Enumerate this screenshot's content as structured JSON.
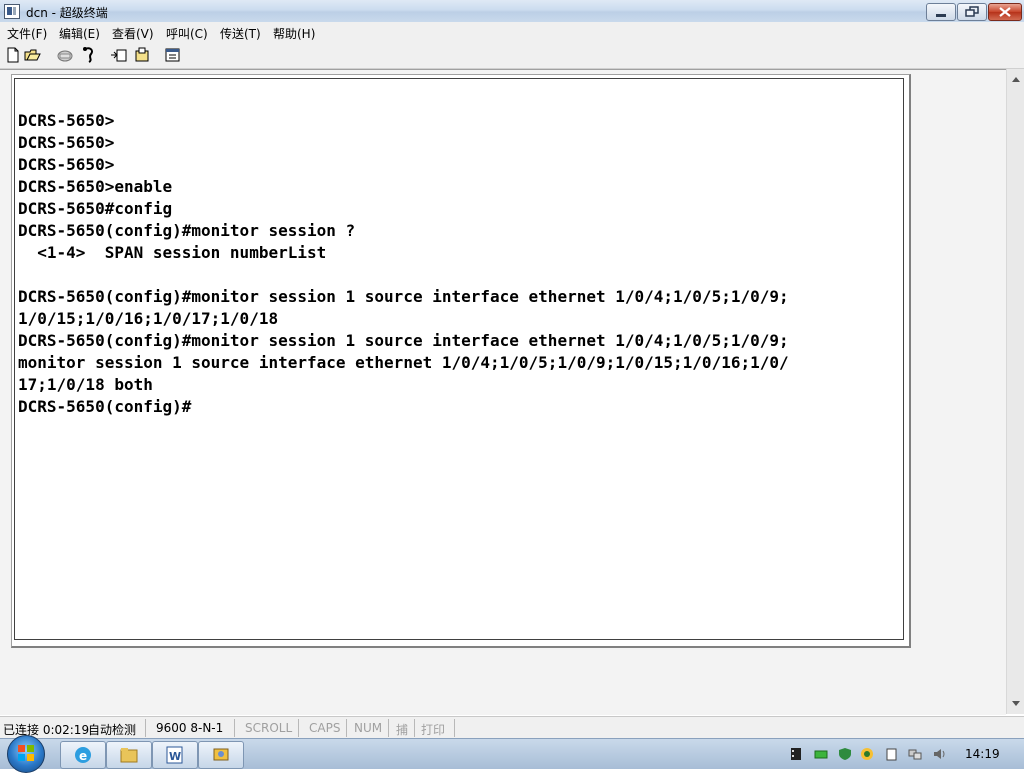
{
  "window": {
    "title": "dcn - 超级终端"
  },
  "menu": {
    "items": [
      "文件(F)",
      "编辑(E)",
      "查看(V)",
      "呼叫(C)",
      "传送(T)",
      "帮助(H)"
    ]
  },
  "toolbar": {
    "icons": [
      "new-icon",
      "open-icon",
      "disconnect-icon",
      "call-icon",
      "send-icon",
      "receive-icon",
      "properties-icon"
    ]
  },
  "terminal": {
    "lines": [
      "DCRS-5650>",
      "DCRS-5650>",
      "DCRS-5650>",
      "DCRS-5650>enable",
      "DCRS-5650#config",
      "DCRS-5650(config)#monitor session ?",
      "  <1-4>  SPAN session numberList",
      "",
      "DCRS-5650(config)#monitor session 1 source interface ethernet 1/0/4;1/0/5;1/0/9;",
      "1/0/15;1/0/16;1/0/17;1/0/18",
      "DCRS-5650(config)#monitor session 1 source interface ethernet 1/0/4;1/0/5;1/0/9;",
      "monitor session 1 source interface ethernet 1/0/4;1/0/5;1/0/9;1/0/15;1/0/16;1/0/",
      "17;1/0/18 both",
      "DCRS-5650(config)#"
    ]
  },
  "status": {
    "connection": "已连接 0:02:19",
    "detect": "自动检测",
    "baud": "9600 8-N-1",
    "scroll": "SCROLL",
    "caps": "CAPS",
    "num": "NUM",
    "capture": "捕",
    "print": "打印"
  },
  "taskbar": {
    "clock": "14:19",
    "buttons": [
      "ie-icon",
      "explorer-icon",
      "word-icon",
      "hyperterminal-icon"
    ]
  }
}
